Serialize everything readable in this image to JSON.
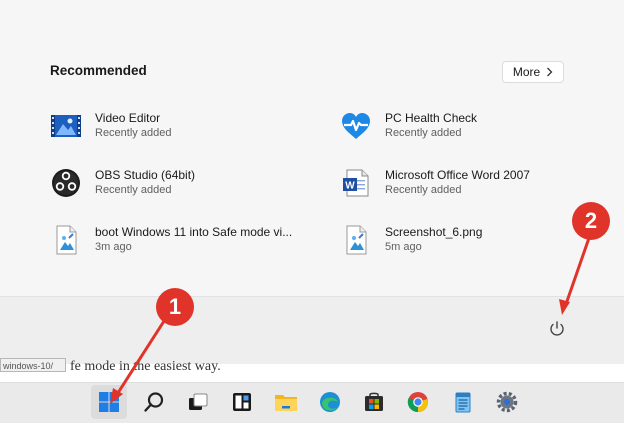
{
  "start_menu": {
    "recommended_title": "Recommended",
    "more_label": "More",
    "items": [
      {
        "name": "Video Editor",
        "sub": "Recently added",
        "icon": "video-editor-icon"
      },
      {
        "name": "PC Health Check",
        "sub": "Recently added",
        "icon": "pc-health-check-icon"
      },
      {
        "name": "OBS Studio (64bit)",
        "sub": "Recently added",
        "icon": "obs-studio-icon"
      },
      {
        "name": "Microsoft Office Word 2007",
        "sub": "Recently added",
        "icon": "word-icon"
      },
      {
        "name": "boot Windows 11 into Safe mode vi...",
        "sub": "3m ago",
        "icon": "image-file-icon"
      },
      {
        "name": "Screenshot_6.png",
        "sub": "5m ago",
        "icon": "image-file-icon"
      }
    ],
    "power_icon": "power-icon"
  },
  "background_page": {
    "tooltip": "windows-10/",
    "snippet": "fe mode in the easiest way."
  },
  "taskbar": {
    "icons": [
      "start-icon",
      "search-icon",
      "task-view-icon",
      "widgets-icon",
      "file-explorer-icon",
      "edge-icon",
      "store-icon",
      "chrome-icon",
      "notepad-icon",
      "settings-icon"
    ]
  },
  "annotations": {
    "marker_1": "1",
    "marker_2": "2",
    "color": "#e0342a"
  }
}
